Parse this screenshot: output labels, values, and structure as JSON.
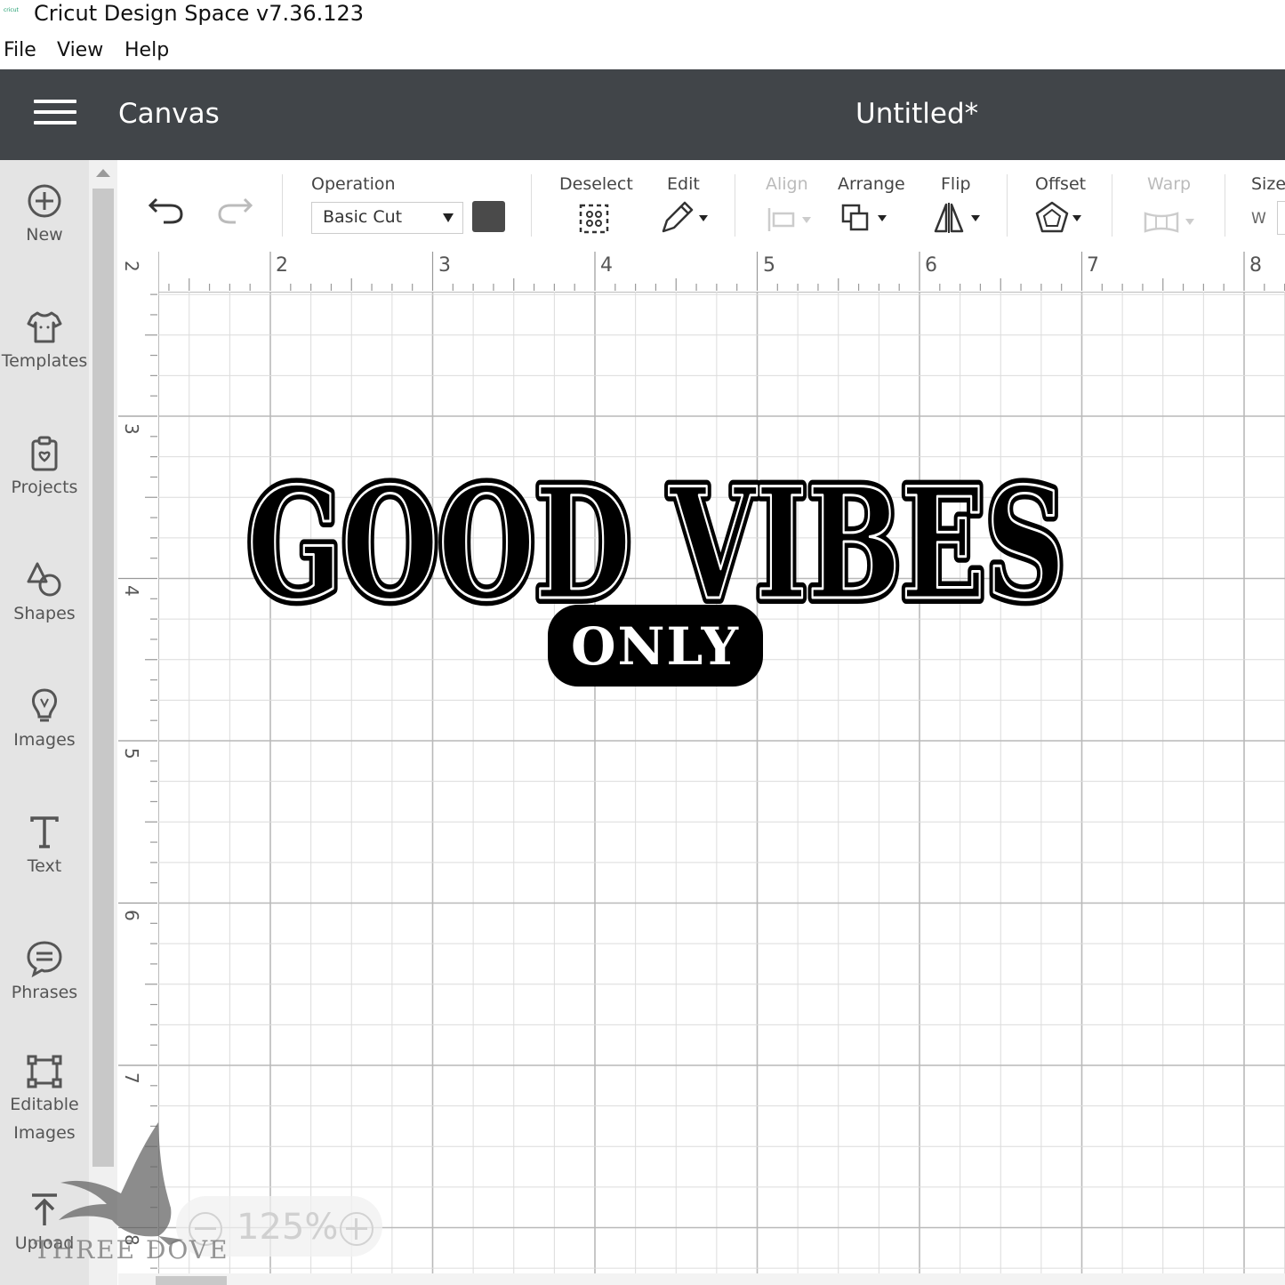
{
  "window": {
    "logo_text": "cricut",
    "title": "Cricut Design Space  v7.36.123"
  },
  "menubar": {
    "items": [
      "File",
      "View",
      "Help"
    ]
  },
  "header": {
    "section": "Canvas",
    "document_title": "Untitled*"
  },
  "sidebar": {
    "items": [
      {
        "label": "New",
        "icon": "plus-circle-icon"
      },
      {
        "label": "Templates",
        "icon": "tshirt-icon"
      },
      {
        "label": "Projects",
        "icon": "projects-icon"
      },
      {
        "label": "Shapes",
        "icon": "shapes-icon"
      },
      {
        "label": "Images",
        "icon": "lightbulb-icon"
      },
      {
        "label": "Text",
        "icon": "text-icon"
      },
      {
        "label": "Phrases",
        "icon": "speech-bubble-icon"
      },
      {
        "label": "Editable Images",
        "icon": "editable-images-icon"
      },
      {
        "label": "Upload",
        "icon": "upload-icon"
      }
    ]
  },
  "toolbar": {
    "operation_label": "Operation",
    "operation_value": "Basic Cut",
    "swatch_color": "#4a4a4a",
    "deselect_label": "Deselect",
    "edit_label": "Edit",
    "align_label": "Align",
    "arrange_label": "Arrange",
    "flip_label": "Flip",
    "offset_label": "Offset",
    "warp_label": "Warp",
    "size_label": "Size",
    "size_w_label": "W"
  },
  "ruler": {
    "top_numbers": [
      "2",
      "3",
      "4",
      "5",
      "6",
      "7",
      "8"
    ],
    "left_numbers": [
      "2",
      "3",
      "4",
      "5",
      "6",
      "7",
      "8"
    ]
  },
  "design": {
    "line1": "GOOD VIBES",
    "line2": "ONLY"
  },
  "zoom": {
    "value": "125%"
  },
  "watermark": {
    "text": "THREE DOVE"
  }
}
